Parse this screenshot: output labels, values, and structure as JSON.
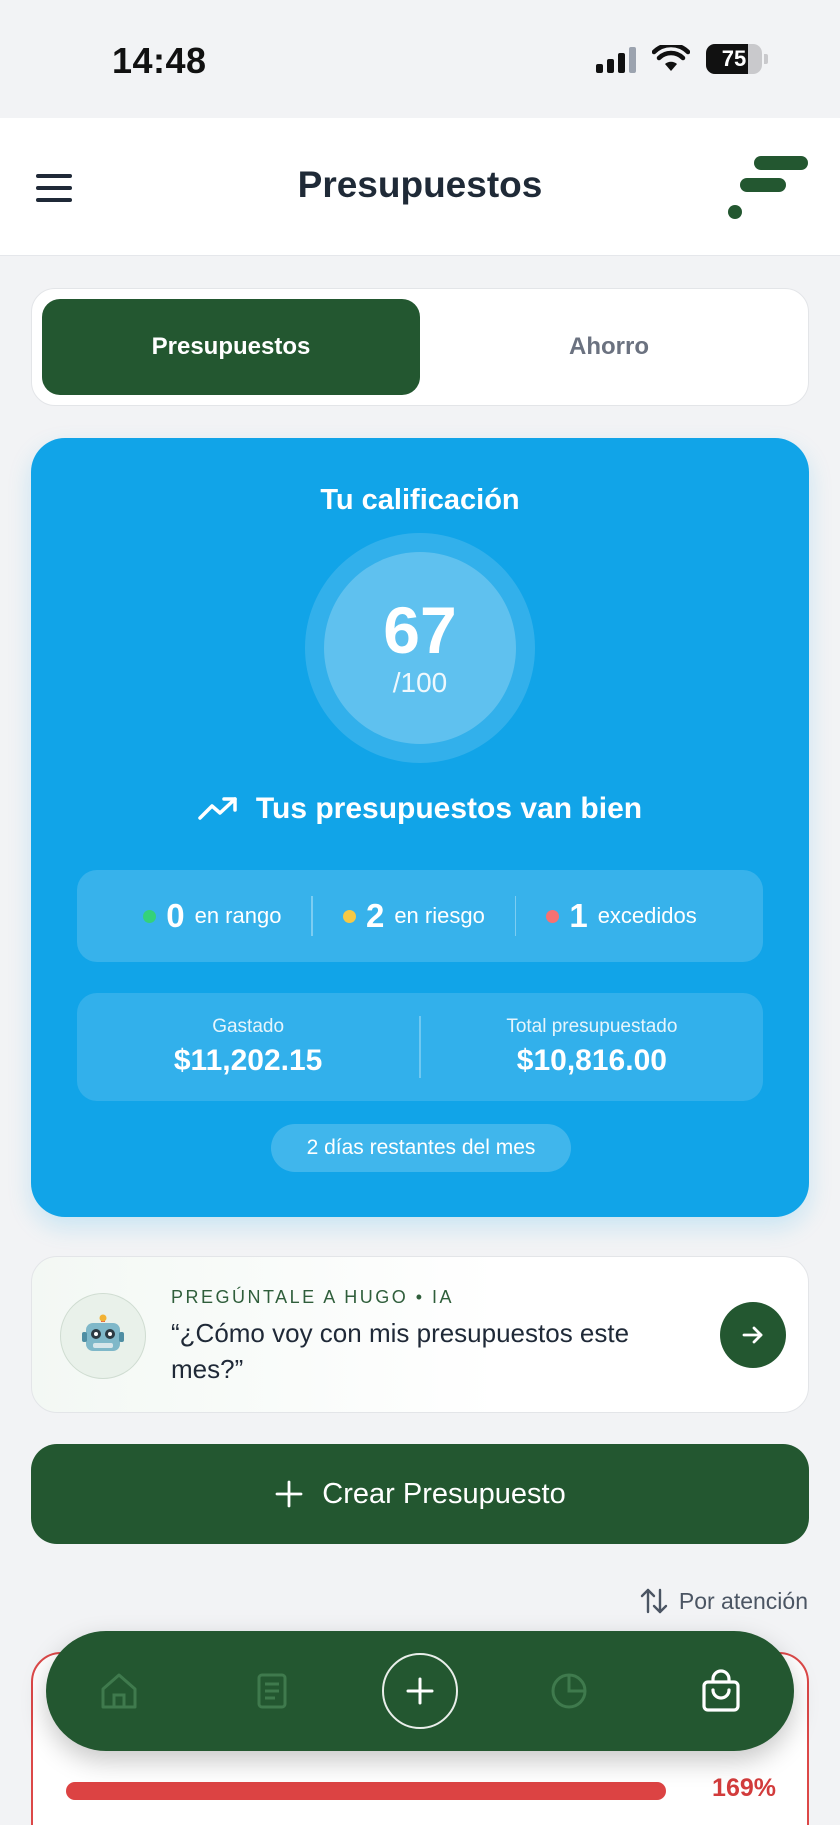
{
  "status_bar": {
    "time": "14:48",
    "battery": "75"
  },
  "header": {
    "title": "Presupuestos"
  },
  "tabs": [
    {
      "label": "Presupuestos",
      "active": true
    },
    {
      "label": "Ahorro",
      "active": false
    }
  ],
  "score_card": {
    "title": "Tu calificación",
    "score": "67",
    "score_max": "/100",
    "status_text": "Tus presupuestos van bien",
    "counts": [
      {
        "num": "0",
        "label": "en rango",
        "color": "#34d27a"
      },
      {
        "num": "2",
        "label": "en riesgo",
        "color": "#f6c945"
      },
      {
        "num": "1",
        "label": "excedidos",
        "color": "#f87171"
      }
    ],
    "spent_label": "Gastado",
    "spent_value": "$11,202.15",
    "budgeted_label": "Total presupuestado",
    "budgeted_value": "$10,816.00",
    "days_left": "2 días restantes del mes"
  },
  "ask_hugo": {
    "eyebrow": "PREGÚNTALE A HUGO • IA",
    "question": "“¿Cómo voy con mis presupuestos este mes?”"
  },
  "create_button": {
    "label": "Crear Presupuesto"
  },
  "sort": {
    "label": "Por atención"
  },
  "budget_item": {
    "progress_percent": "169%",
    "progress_fraction": 1.0
  },
  "bottom_nav": {
    "items": [
      "home-icon",
      "receipt-icon",
      "add-icon",
      "pie-chart-icon",
      "shopping-bag-icon"
    ],
    "active": "shopping-bag-icon"
  },
  "colors": {
    "brand_green": "#235730",
    "card_blue": "#11a4e8",
    "danger_red": "#dc4343"
  }
}
